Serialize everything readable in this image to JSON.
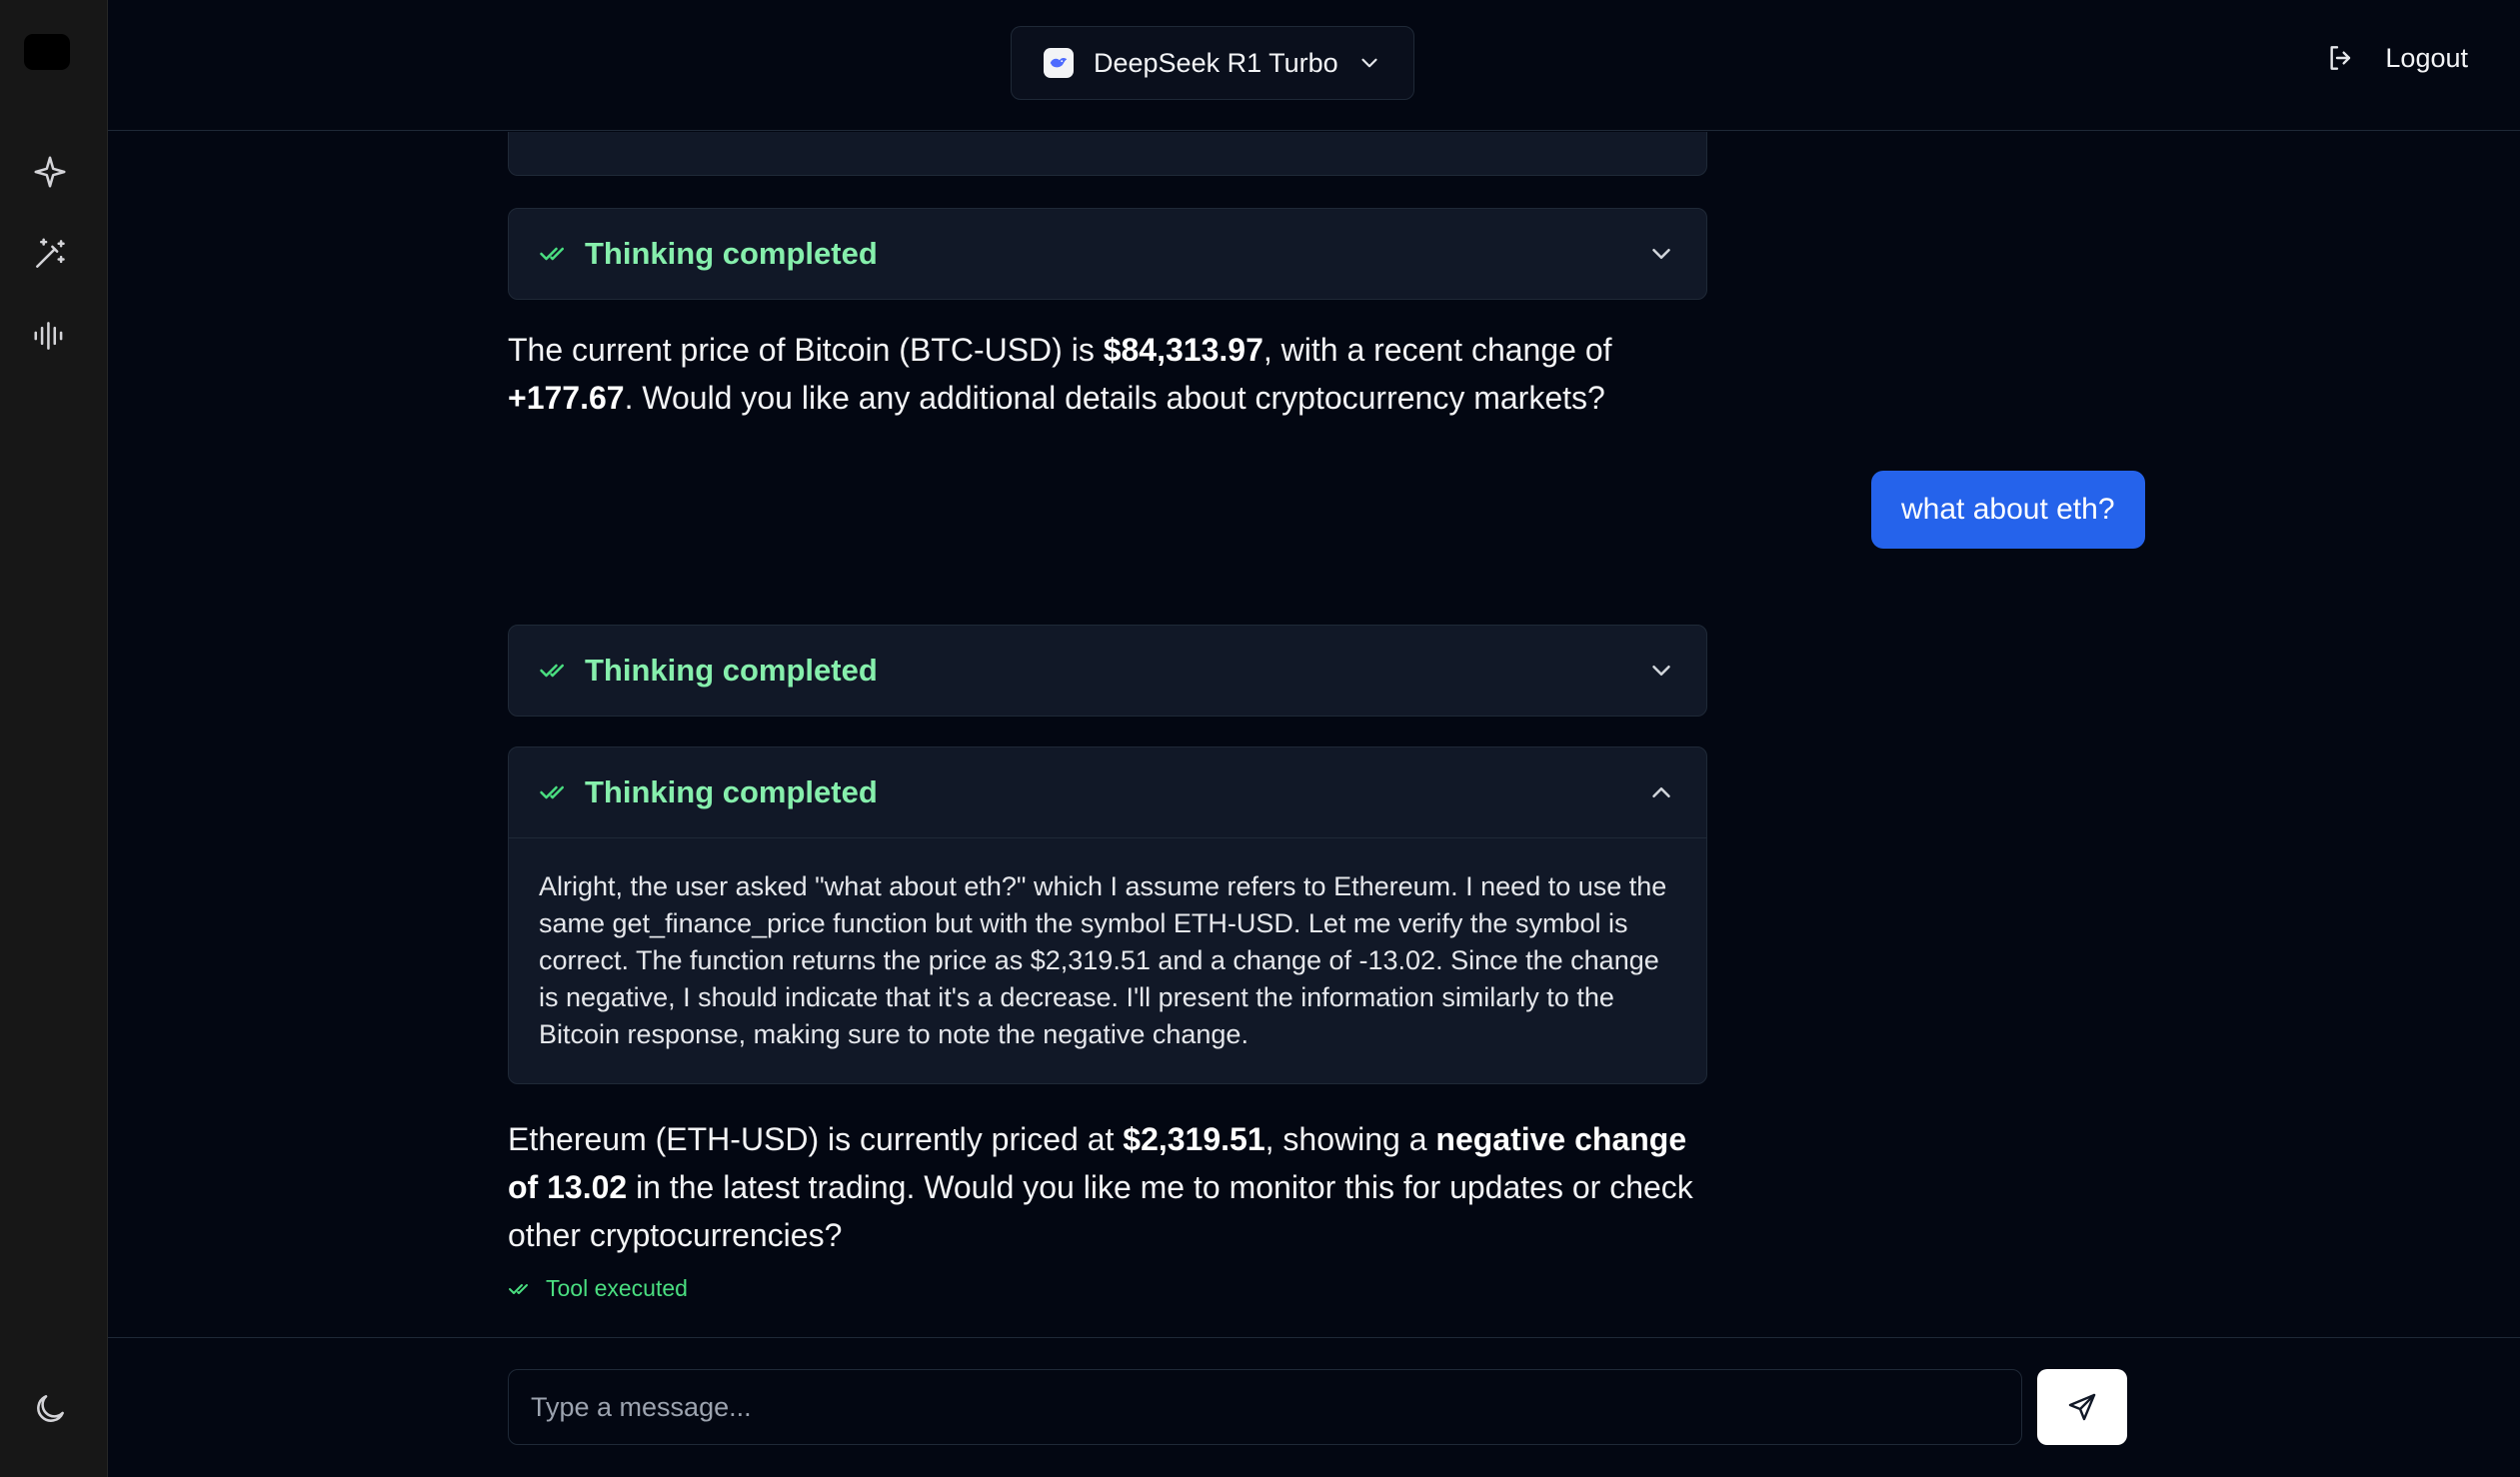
{
  "header": {
    "model_name": "DeepSeek R1 Turbo",
    "logout_label": "Logout"
  },
  "sidebar": {
    "icons": [
      "sparkle-icon",
      "magic-wand-icon",
      "audio-waveform-icon",
      "moon-icon"
    ]
  },
  "chat": {
    "thinking_label": "Thinking completed",
    "thinking_expanded_text": "Alright, the user asked \"what about eth?\" which I assume refers to Ethereum. I need to use the same get_finance_price function but with the symbol ETH-USD. Let me verify the symbol is correct. The function returns the price as $2,319.51 and a change of -13.02. Since the change is negative, I should indicate that it's a decrease. I'll present the information similarly to the Bitcoin response, making sure to note the negative change.",
    "assistant_1": {
      "p1": "The current price of Bitcoin (BTC-USD) is ",
      "b1": "$84,313.97",
      "p2": ", with a recent change of ",
      "b2": "+177.67",
      "p3": ". Would you like any additional details about cryptocurrency markets?"
    },
    "user_message": "what about eth?",
    "assistant_2": {
      "p1": "Ethereum (ETH-USD) is currently priced at ",
      "b1": "$2,319.51",
      "p2": ", showing a ",
      "b2": "negative change of 13.02",
      "p3": " in the latest trading. Would you like me to monitor this for updates or check other cryptocurrencies?"
    },
    "tool_status": "Tool executed"
  },
  "input": {
    "placeholder": "Type a message..."
  },
  "colors": {
    "background": "#030712",
    "sidebar": "#171717",
    "panel": "#111827",
    "accent_green": "#86efac",
    "user_bubble": "#2563eb"
  }
}
